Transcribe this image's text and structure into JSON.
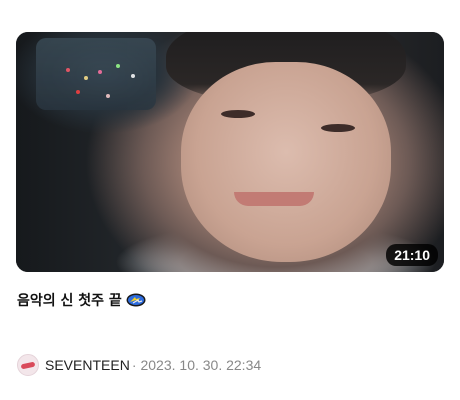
{
  "video": {
    "duration": "21:10",
    "title": "음악의 신 첫주 끝",
    "title_emoji_icon": "uno-reverse-card-icon"
  },
  "channel": {
    "name": "SEVENTEEN",
    "separator": "·",
    "date": "2023. 10. 30. 22:34",
    "avatar_icon": "seventeen-logo-icon"
  },
  "colors": {
    "duration_badge_bg": "#000000",
    "title_text": "#111111",
    "meta_text": "#888888"
  }
}
